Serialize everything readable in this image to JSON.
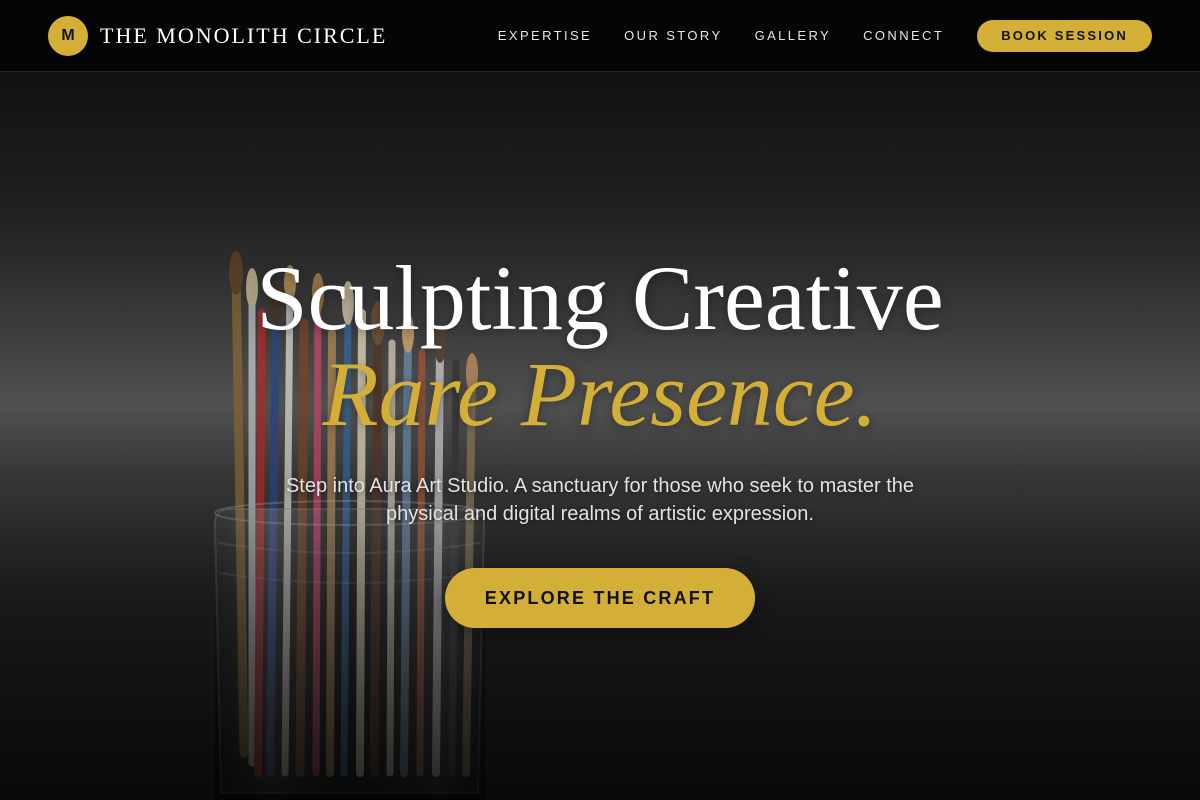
{
  "brand": {
    "mark": "M",
    "name": "THE MONOLITH CIRCLE"
  },
  "nav": {
    "links": [
      "EXPERTISE",
      "OUR STORY",
      "GALLERY",
      "CONNECT"
    ],
    "cta": "BOOK SESSION"
  },
  "hero": {
    "title_line1": "Sculpting Creative",
    "title_line2": "Rare Presence.",
    "subtitle": "Step into Aura Art Studio. A sanctuary for those who seek to master the physical and digital realms of artistic expression.",
    "cta": "EXPLORE THE CRAFT",
    "background_image": "paintbrushes-in-glass-jar"
  },
  "colors": {
    "accent": "#d4af37",
    "nav_background": "#050505",
    "text": "#ffffff"
  }
}
